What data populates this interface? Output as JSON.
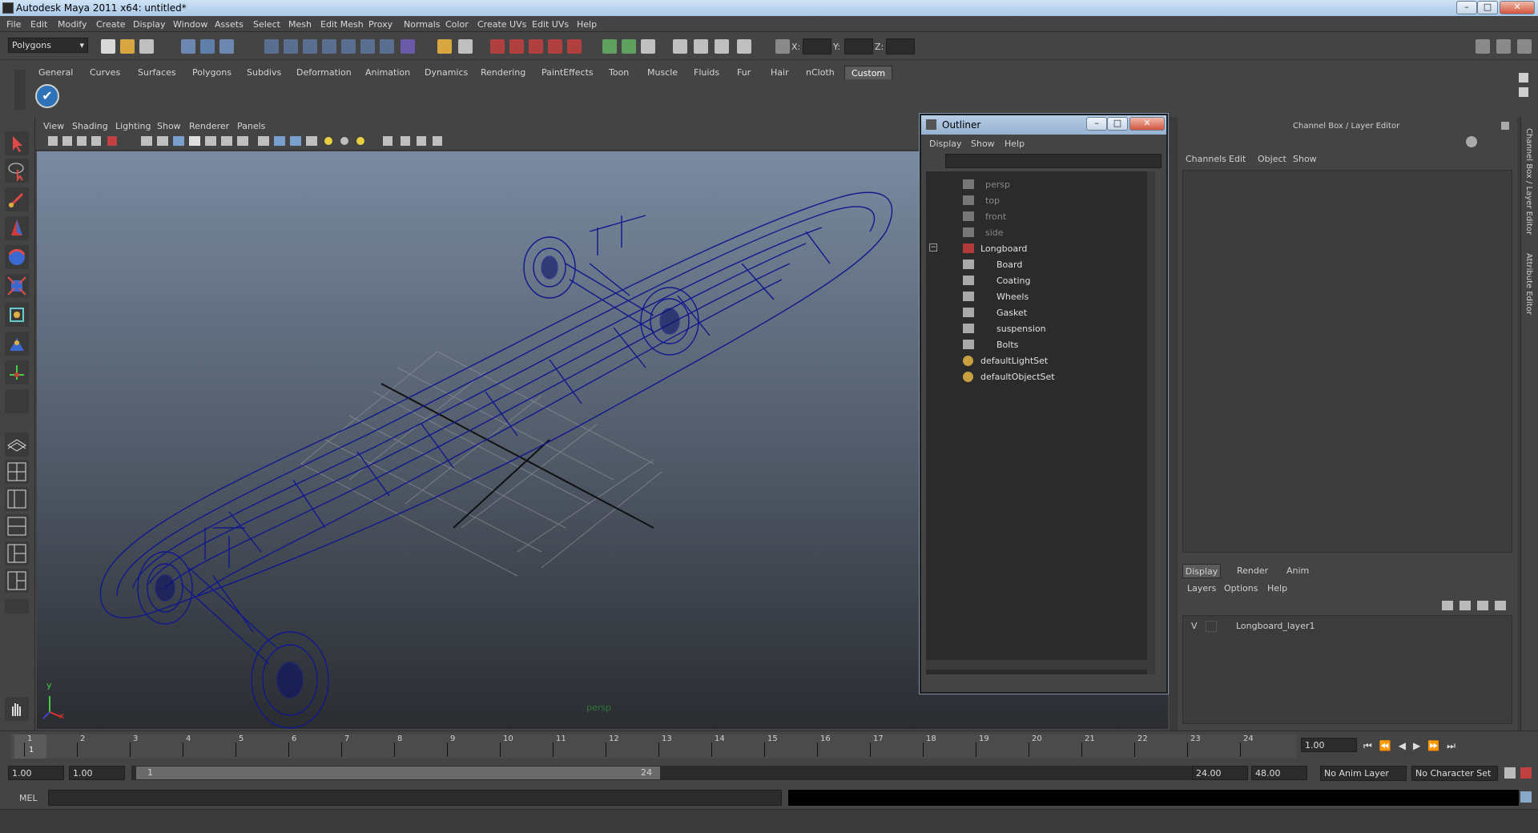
{
  "window": {
    "title": "Autodesk Maya 2011 x64: untitled*"
  },
  "menu": [
    "File",
    "Edit",
    "Modify",
    "Create",
    "Display",
    "Window",
    "Assets",
    "Select",
    "Mesh",
    "Edit Mesh",
    "Proxy",
    "Normals",
    "Color",
    "Create UVs",
    "Edit UVs",
    "Help"
  ],
  "status": {
    "mode": "Polygons",
    "x_label": "X:",
    "y_label": "Y:",
    "z_label": "Z:"
  },
  "shelf": {
    "tabs": [
      "General",
      "Curves",
      "Surfaces",
      "Polygons",
      "Subdivs",
      "Deformation",
      "Animation",
      "Dynamics",
      "Rendering",
      "PaintEffects",
      "Toon",
      "Muscle",
      "Fluids",
      "Fur",
      "Hair",
      "nCloth",
      "Custom"
    ],
    "active": "Custom"
  },
  "viewport": {
    "menu": [
      "View",
      "Shading",
      "Lighting",
      "Show",
      "Renderer",
      "Panels"
    ],
    "camera": "persp",
    "axis_y": "y",
    "axis_x": "x"
  },
  "outliner": {
    "title": "Outliner",
    "menu": [
      "Display",
      "Show",
      "Help"
    ],
    "cameras": [
      "persp",
      "top",
      "front",
      "side"
    ],
    "group": "Longboard",
    "group_toggle": "−",
    "children": [
      "Board",
      "Coating",
      "Wheels",
      "Gasket",
      "suspension",
      "Bolts"
    ],
    "sets": [
      "defaultLightSet",
      "defaultObjectSet"
    ]
  },
  "channel_box": {
    "title": "Channel Box / Layer Editor",
    "menu": [
      "Channels",
      "Edit",
      "Object",
      "Show"
    ],
    "layer_tabs": [
      "Display",
      "Render",
      "Anim"
    ],
    "layer_active": "Display",
    "layer_menu": [
      "Layers",
      "Options",
      "Help"
    ],
    "layer": {
      "visible": "V",
      "name": "Longboard_layer1"
    }
  },
  "right_tabs": [
    "Channel Box / Layer Editor",
    "Attribute Editor"
  ],
  "time_slider": {
    "ticks": [
      "1",
      "2",
      "3",
      "4",
      "5",
      "6",
      "7",
      "8",
      "9",
      "10",
      "11",
      "12",
      "13",
      "14",
      "15",
      "16",
      "17",
      "18",
      "19",
      "20",
      "21",
      "22",
      "23",
      "24"
    ],
    "current_marker": "1",
    "current_frame": "1.00"
  },
  "range_slider": {
    "start": "1.00",
    "playback_start": "1.00",
    "range_start_label": "1",
    "range_end_label": "24",
    "playback_end": "24.00",
    "end": "48.00",
    "anim_layer": "No Anim Layer",
    "character_set": "No Character Set"
  },
  "command_line": {
    "label": "MEL"
  }
}
